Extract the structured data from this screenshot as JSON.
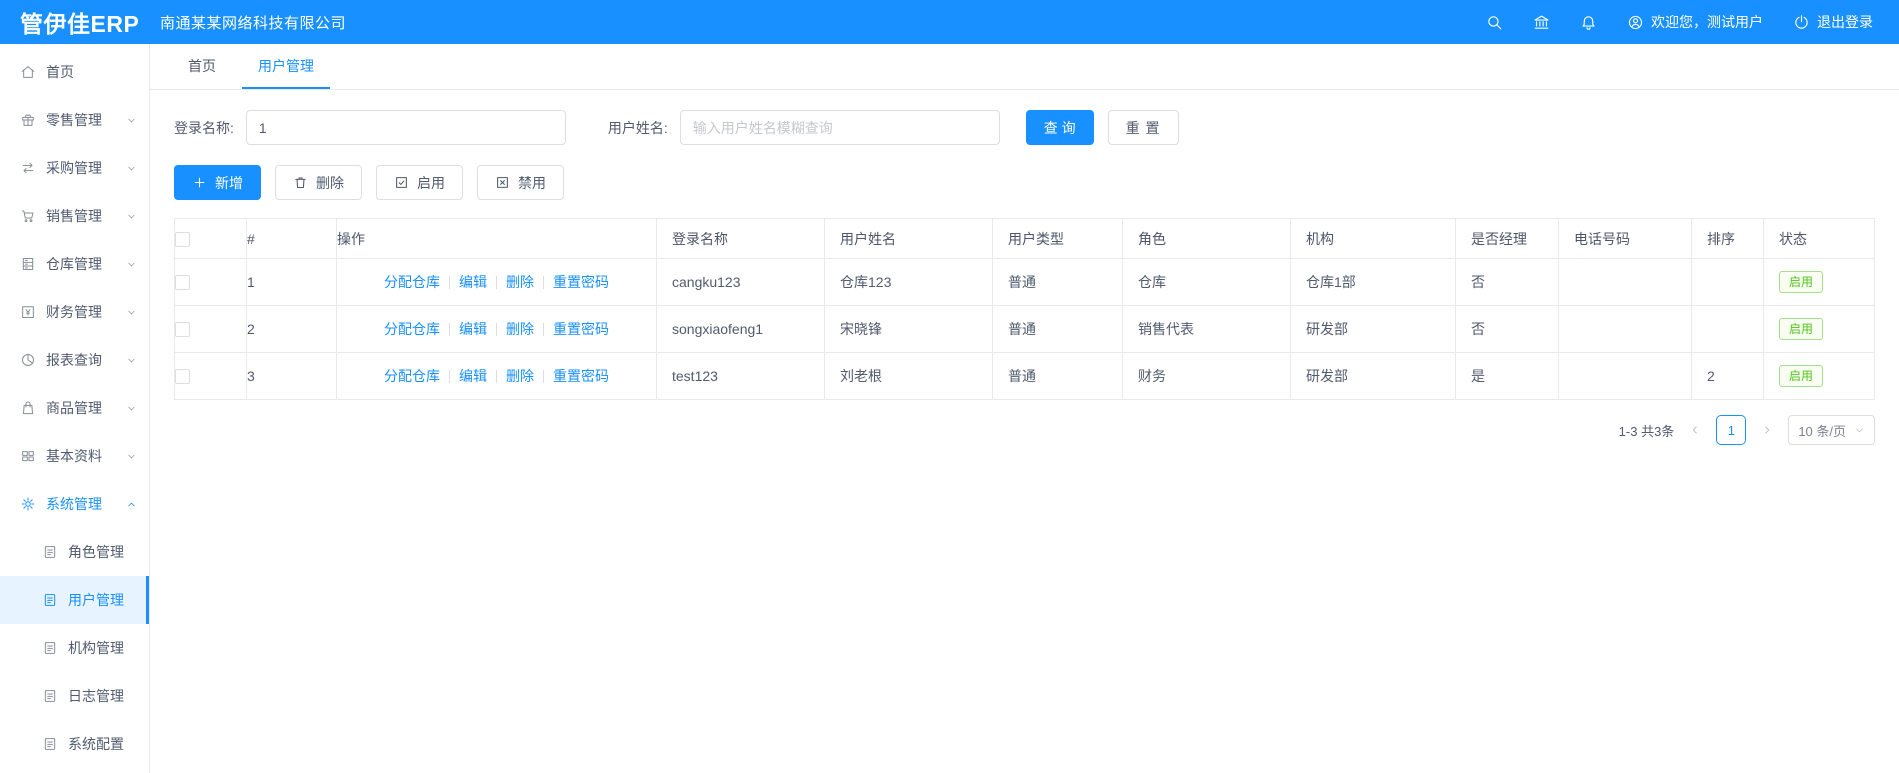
{
  "colors": {
    "primary": "#1890ff",
    "success": "#52c41a"
  },
  "header": {
    "logo": "管伊佳ERP",
    "company": "南通某某网络科技有限公司",
    "welcome": "欢迎您，测试用户",
    "logout": "退出登录"
  },
  "sidebar": {
    "items": [
      {
        "label": "首页",
        "icon": "home-icon"
      },
      {
        "label": "零售管理",
        "icon": "retail-icon"
      },
      {
        "label": "采购管理",
        "icon": "purchase-icon"
      },
      {
        "label": "销售管理",
        "icon": "sales-cart-icon"
      },
      {
        "label": "仓库管理",
        "icon": "warehouse-icon"
      },
      {
        "label": "财务管理",
        "icon": "finance-icon"
      },
      {
        "label": "报表查询",
        "icon": "report-pie-icon"
      },
      {
        "label": "商品管理",
        "icon": "goods-bag-icon"
      },
      {
        "label": "基本资料",
        "icon": "basic-data-icon"
      },
      {
        "label": "系统管理",
        "icon": "gear-icon",
        "active": true
      }
    ],
    "system_children": [
      {
        "label": "角色管理"
      },
      {
        "label": "用户管理",
        "active": true
      },
      {
        "label": "机构管理"
      },
      {
        "label": "日志管理"
      },
      {
        "label": "系统配置"
      }
    ]
  },
  "tabs": [
    {
      "label": "首页"
    },
    {
      "label": "用户管理",
      "active": true
    }
  ],
  "search": {
    "login_label": "登录名称:",
    "login_value": "1",
    "name_label": "用户姓名:",
    "name_placeholder": "输入用户姓名模糊查询",
    "query_label": "查 询",
    "reset_label": "重 置"
  },
  "toolbar": {
    "add_label": "新增",
    "delete_label": "删除",
    "enable_label": "启用",
    "disable_label": "禁用"
  },
  "table": {
    "headers": [
      "#",
      "操作",
      "登录名称",
      "用户姓名",
      "用户类型",
      "角色",
      "机构",
      "是否经理",
      "电话号码",
      "排序",
      "状态"
    ],
    "action_labels": {
      "assign": "分配仓库",
      "edit": "编辑",
      "del": "删除",
      "reset_pwd": "重置密码"
    },
    "rows": [
      {
        "index": "1",
        "login": "cangku123",
        "name": "仓库123",
        "type": "普通",
        "role": "仓库",
        "org": "仓库1部",
        "manager": "否",
        "phone": "",
        "sort": "",
        "status": "启用"
      },
      {
        "index": "2",
        "login": "songxiaofeng1",
        "name": "宋晓锋",
        "type": "普通",
        "role": "销售代表",
        "org": "研发部",
        "manager": "否",
        "phone": "",
        "sort": "",
        "status": "启用"
      },
      {
        "index": "3",
        "login": "test123",
        "name": "刘老根",
        "type": "普通",
        "role": "财务",
        "org": "研发部",
        "manager": "是",
        "phone": "",
        "sort": "2",
        "status": "启用"
      }
    ]
  },
  "pagination": {
    "total_text": "1-3 共3条",
    "current_page": "1",
    "page_size": "10 条/页"
  }
}
